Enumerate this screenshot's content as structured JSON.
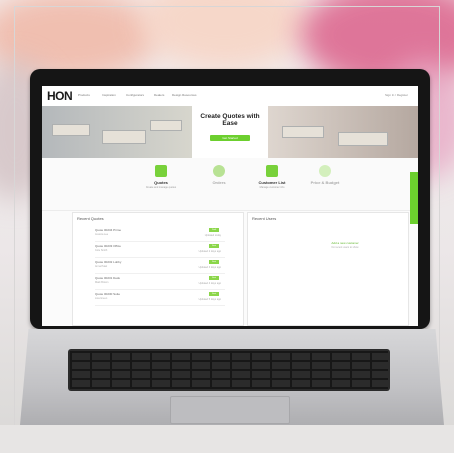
{
  "site": {
    "logo": "HON",
    "nav_items": [
      "Products",
      "Inspiration",
      "Configurators",
      "Dealers",
      "Design Resources"
    ],
    "signin": "Sign In / Register"
  },
  "hero": {
    "title": "Create Quotes with Ease",
    "button": "Get Started"
  },
  "features": [
    {
      "label": "Quotes",
      "desc": "Create and manage quotes",
      "icon": "quote-icon",
      "color": "#78d13a"
    },
    {
      "label": "Orders",
      "desc": "",
      "icon": "orders-icon",
      "color": "#b8e294"
    },
    {
      "label": "Customer List",
      "desc": "Manage customer info",
      "icon": "customer-list-icon",
      "color": "#78d13a"
    },
    {
      "label": "Price & Budget",
      "desc": "",
      "icon": "price-icon",
      "color": "#d3efbc"
    }
  ],
  "recent_quotes": {
    "title": "Recent Quotes",
    "items": [
      {
        "name": "Quote 00234 Prime",
        "sub": "Jessica Lee",
        "badge": "Draft",
        "status": "Updated today"
      },
      {
        "name": "Quote 00233 Office",
        "sub": "Cole Smith",
        "badge": "Sent",
        "status": "Updated 2 days ago"
      },
      {
        "name": "Quote 00232 Lobby",
        "sub": "Anna Patel",
        "badge": "Sent",
        "status": "Updated 3 days ago"
      },
      {
        "name": "Quote 00231 Desk",
        "sub": "Mark Brown",
        "badge": "Sent",
        "status": "Updated 4 days ago"
      },
      {
        "name": "Quote 00230 Suite",
        "sub": "Lisa Green",
        "badge": "Sent",
        "status": "Updated 5 days ago"
      }
    ]
  },
  "recent_users": {
    "title": "Recent Users",
    "empty_link": "Add a new customer",
    "empty_text": "No recent users to show"
  },
  "colors": {
    "accent": "#6ccf2e",
    "laptop_frame": "#151515",
    "background": "#ecebea"
  }
}
